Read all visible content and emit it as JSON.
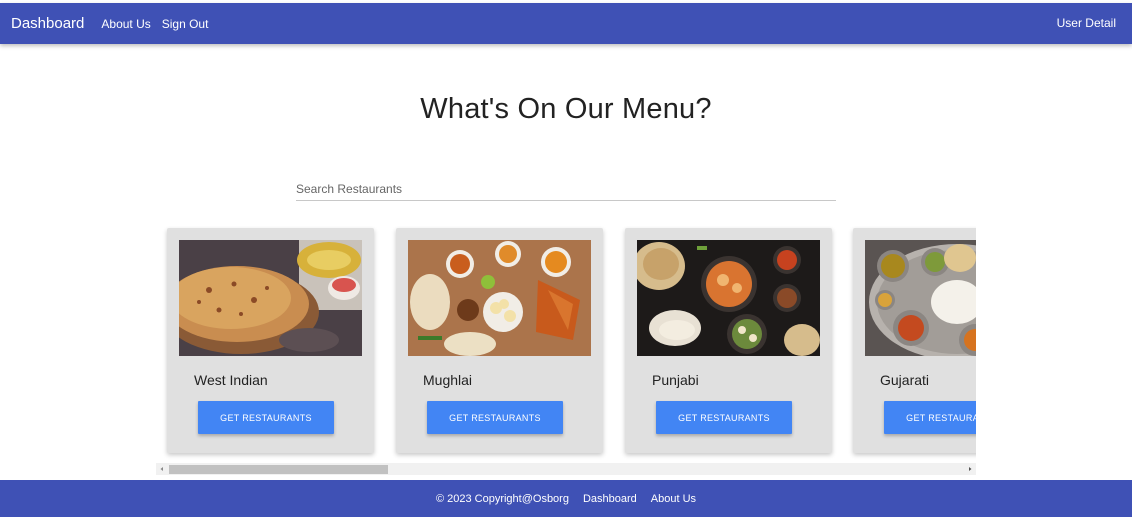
{
  "navbar": {
    "brand": "Dashboard",
    "links": [
      "About Us",
      "Sign Out"
    ],
    "user_detail": "User Detail"
  },
  "main": {
    "heading": "What's On Our Menu?",
    "search_placeholder": "Search Restaurants"
  },
  "cards": [
    {
      "title": "West Indian",
      "button": "GET RESTAURANTS"
    },
    {
      "title": "Mughlai",
      "button": "GET RESTAURANTS"
    },
    {
      "title": "Punjabi",
      "button": "GET RESTAURANTS"
    },
    {
      "title": "Gujarati",
      "button": "GET RESTAURANTS"
    }
  ],
  "footer": {
    "copyright": "© 2023 Copyright@Osborg",
    "links": [
      "Dashboard",
      "About Us"
    ]
  },
  "colors": {
    "primary": "#3f51b5",
    "button": "#4285f4",
    "card_bg": "#e0e0e0"
  }
}
